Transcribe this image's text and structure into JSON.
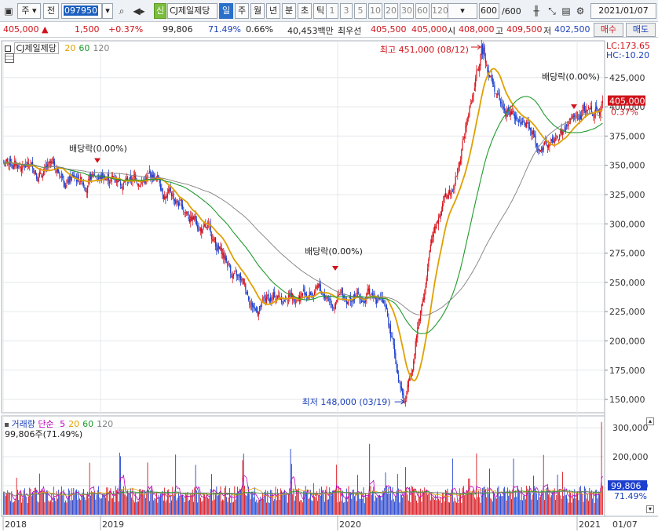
{
  "toolbar": {
    "market": "주",
    "prefix": "전",
    "code": "097950",
    "new_badge": "신",
    "name": "CJ제일제당",
    "periods": [
      {
        "label": "일",
        "selected": true
      },
      {
        "label": "주",
        "selected": false
      },
      {
        "label": "월",
        "selected": false
      },
      {
        "label": "년",
        "selected": false
      },
      {
        "label": "분",
        "selected": false
      },
      {
        "label": "초",
        "selected": false
      },
      {
        "label": "틱",
        "selected": false
      }
    ],
    "numbers": [
      "1",
      "3",
      "5",
      "10",
      "20",
      "30",
      "60",
      "120"
    ],
    "count": "600",
    "count_total": "/600",
    "date": "2021/01/07"
  },
  "quote": {
    "price": "405,000",
    "up_mark": "▲",
    "change": "1,500",
    "change_pct": "+0.37%",
    "volume": "99,806",
    "volume_ratio": "71.49%",
    "turnover": "0.66%",
    "amount": "40,453백만",
    "best_label": "최우선",
    "ask": "405,500",
    "bid": "405,000",
    "open_label": "시",
    "open": "408,000",
    "high_label": "고",
    "high": "409,500",
    "low_label": "저",
    "low": "402,500",
    "buy": "매수",
    "sell": "매도"
  },
  "price_panel": {
    "legend_name": "CJ제일제당",
    "ma_labels": [
      {
        "label": "20",
        "color": "#e0a000"
      },
      {
        "label": "60",
        "color": "#1f9a2c"
      },
      {
        "label": "120",
        "color": "#808080"
      }
    ],
    "lc": "LC:173.65",
    "hc": "HC:-10.20",
    "current_tag": "405,000",
    "current_pct": "0.37%",
    "y_ticks": [
      "425,000",
      "400,000",
      "375,000",
      "350,000",
      "325,000",
      "300,000",
      "275,000",
      "250,000",
      "225,000",
      "200,000",
      "175,000",
      "150,000"
    ],
    "annotations": {
      "high": "최고 451,000 (08/12)",
      "low": "최저 148,000 (03/19)",
      "div1": "배당락(0.00%)",
      "div2": "배당락(0.00%)",
      "div3": "배당락(0.00%)"
    }
  },
  "volume_panel": {
    "title": "거래량",
    "type": "단순",
    "ma_labels": [
      {
        "label": "5",
        "color": "#c000c0"
      },
      {
        "label": "20",
        "color": "#e0a000"
      },
      {
        "label": "60",
        "color": "#1f9a2c"
      },
      {
        "label": "120",
        "color": "#808080"
      }
    ],
    "current": "99,806주(71.49%)",
    "y_ticks": [
      "300,000",
      "200,000",
      "100,000"
    ],
    "tag_value": "99,806",
    "tag_pct": "71.49%"
  },
  "x_axis": {
    "labels": [
      "2018",
      "2019",
      "2020",
      "2021"
    ],
    "current_date": "01/07"
  },
  "chart_data": {
    "type": "candlestick",
    "price_range": [
      140000,
      455000
    ],
    "volume_range": [
      0,
      330000
    ],
    "series": [
      {
        "name": "20",
        "color": "#e0a000"
      },
      {
        "name": "60",
        "color": "#1f9a2c"
      },
      {
        "name": "120",
        "color": "#808080"
      }
    ],
    "anchors_x": [
      0,
      0.12,
      0.25,
      0.33,
      0.42,
      0.5,
      0.55,
      0.63,
      0.67,
      0.72,
      0.76,
      0.8,
      0.83,
      0.88,
      0.9,
      1
    ],
    "anchors_price": [
      352000,
      340000,
      340000,
      300000,
      230000,
      245000,
      237000,
      240000,
      148000,
      300000,
      355000,
      451000,
      400000,
      380000,
      360000,
      405000
    ]
  }
}
